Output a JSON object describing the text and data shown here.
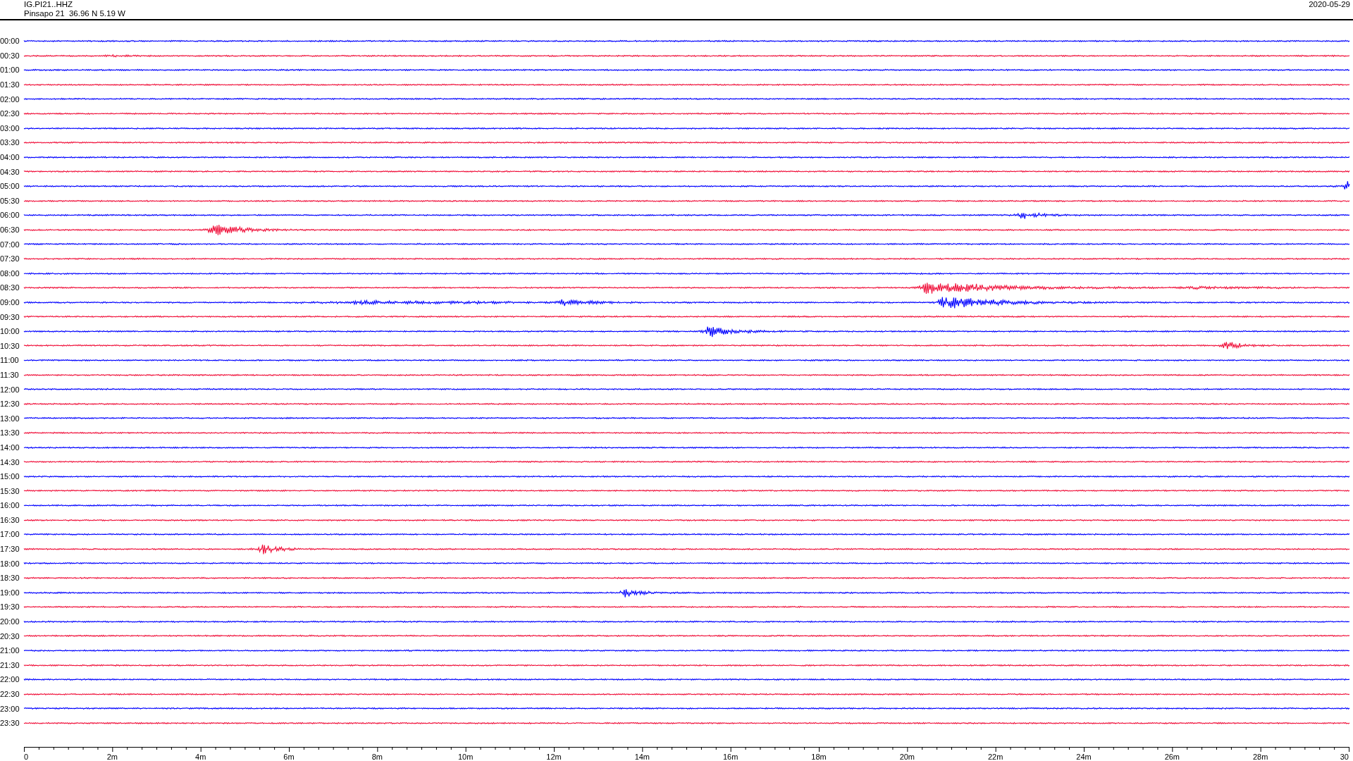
{
  "header": {
    "station_code": "IG.PI21..HHZ",
    "station_info": "Pinsapo 21  36.96 N 5.19 W",
    "date": "2020-05-29"
  },
  "rows": [
    {
      "time": "00:00",
      "color": "#0000ff"
    },
    {
      "time": "00:30",
      "color": "#f0103a"
    },
    {
      "time": "01:00",
      "color": "#0000ff"
    },
    {
      "time": "01:30",
      "color": "#f0103a"
    },
    {
      "time": "02:00",
      "color": "#0000ff"
    },
    {
      "time": "02:30",
      "color": "#f0103a"
    },
    {
      "time": "03:00",
      "color": "#0000ff"
    },
    {
      "time": "03:30",
      "color": "#f0103a"
    },
    {
      "time": "04:00",
      "color": "#0000ff"
    },
    {
      "time": "04:30",
      "color": "#f0103a"
    },
    {
      "time": "05:00",
      "color": "#0000ff"
    },
    {
      "time": "05:30",
      "color": "#f0103a"
    },
    {
      "time": "06:00",
      "color": "#0000ff"
    },
    {
      "time": "06:30",
      "color": "#f0103a"
    },
    {
      "time": "07:00",
      "color": "#0000ff"
    },
    {
      "time": "07:30",
      "color": "#f0103a"
    },
    {
      "time": "08:00",
      "color": "#0000ff"
    },
    {
      "time": "08:30",
      "color": "#f0103a"
    },
    {
      "time": "09:00",
      "color": "#0000ff"
    },
    {
      "time": "09:30",
      "color": "#f0103a"
    },
    {
      "time": "10:00",
      "color": "#0000ff"
    },
    {
      "time": "10:30",
      "color": "#f0103a"
    },
    {
      "time": "11:00",
      "color": "#0000ff"
    },
    {
      "time": "11:30",
      "color": "#f0103a"
    },
    {
      "time": "12:00",
      "color": "#0000ff"
    },
    {
      "time": "12:30",
      "color": "#f0103a"
    },
    {
      "time": "13:00",
      "color": "#0000ff"
    },
    {
      "time": "13:30",
      "color": "#f0103a"
    },
    {
      "time": "14:00",
      "color": "#0000ff"
    },
    {
      "time": "14:30",
      "color": "#f0103a"
    },
    {
      "time": "15:00",
      "color": "#0000ff"
    },
    {
      "time": "15:30",
      "color": "#f0103a"
    },
    {
      "time": "16:00",
      "color": "#0000ff"
    },
    {
      "time": "16:30",
      "color": "#f0103a"
    },
    {
      "time": "17:00",
      "color": "#0000ff"
    },
    {
      "time": "17:30",
      "color": "#f0103a"
    },
    {
      "time": "18:00",
      "color": "#0000ff"
    },
    {
      "time": "18:30",
      "color": "#f0103a"
    },
    {
      "time": "19:00",
      "color": "#0000ff"
    },
    {
      "time": "19:30",
      "color": "#f0103a"
    },
    {
      "time": "20:00",
      "color": "#0000ff"
    },
    {
      "time": "20:30",
      "color": "#f0103a"
    },
    {
      "time": "21:00",
      "color": "#0000ff"
    },
    {
      "time": "21:30",
      "color": "#f0103a"
    },
    {
      "time": "22:00",
      "color": "#0000ff"
    },
    {
      "time": "22:30",
      "color": "#f0103a"
    },
    {
      "time": "23:00",
      "color": "#0000ff"
    },
    {
      "time": "23:30",
      "color": "#f0103a"
    }
  ],
  "x_axis": {
    "ticks": [
      "0",
      "2m",
      "4m",
      "6m",
      "8m",
      "10m",
      "12m",
      "14m",
      "16m",
      "18m",
      "20m",
      "22m",
      "24m",
      "26m",
      "28m",
      "30"
    ]
  }
}
